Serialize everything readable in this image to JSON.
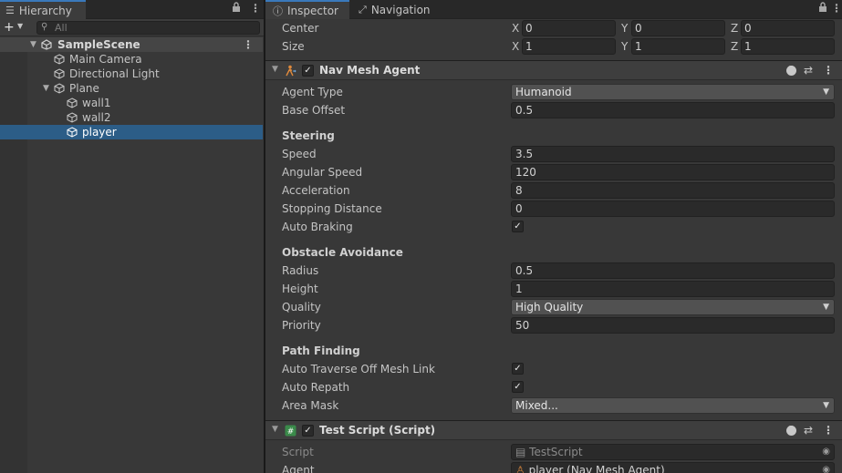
{
  "hierarchy": {
    "tab_label": "Hierarchy",
    "search_placeholder": "All",
    "add_label": "+",
    "items": [
      {
        "label": "SampleScene",
        "kind": "scene"
      },
      {
        "label": "Main Camera",
        "kind": "object"
      },
      {
        "label": "Directional Light",
        "kind": "object"
      },
      {
        "label": "Plane",
        "kind": "object",
        "expanded": true
      },
      {
        "label": "wall1",
        "kind": "object"
      },
      {
        "label": "wall2",
        "kind": "object"
      },
      {
        "label": "player",
        "kind": "object",
        "selected": true
      }
    ]
  },
  "inspector": {
    "tabs": [
      "Inspector",
      "Navigation"
    ],
    "collider": {
      "center": {
        "label": "Center",
        "x": "0",
        "y": "0",
        "z": "0"
      },
      "size": {
        "label": "Size",
        "x": "1",
        "y": "1",
        "z": "1"
      }
    },
    "nav_mesh_agent": {
      "title": "Nav Mesh Agent",
      "enabled": true,
      "agent_type": {
        "label": "Agent Type",
        "value": "Humanoid"
      },
      "base_offset": {
        "label": "Base Offset",
        "value": "0.5"
      },
      "steering": {
        "header": "Steering",
        "speed": {
          "label": "Speed",
          "value": "3.5"
        },
        "angular_speed": {
          "label": "Angular Speed",
          "value": "120"
        },
        "acceleration": {
          "label": "Acceleration",
          "value": "8"
        },
        "stopping_distance": {
          "label": "Stopping Distance",
          "value": "0"
        },
        "auto_braking": {
          "label": "Auto Braking",
          "checked": true
        }
      },
      "obstacle_avoidance": {
        "header": "Obstacle Avoidance",
        "radius": {
          "label": "Radius",
          "value": "0.5"
        },
        "height": {
          "label": "Height",
          "value": "1"
        },
        "quality": {
          "label": "Quality",
          "value": "High Quality"
        },
        "priority": {
          "label": "Priority",
          "value": "50"
        }
      },
      "path_finding": {
        "header": "Path Finding",
        "auto_traverse": {
          "label": "Auto Traverse Off Mesh Link",
          "checked": true
        },
        "auto_repath": {
          "label": "Auto Repath",
          "checked": true
        },
        "area_mask": {
          "label": "Area Mask",
          "value": "Mixed..."
        }
      }
    },
    "test_script": {
      "title": "Test Script (Script)",
      "enabled": true,
      "script": {
        "label": "Script",
        "value": "TestScript"
      },
      "agent": {
        "label": "Agent",
        "value": "player (Nav Mesh Agent)"
      }
    }
  },
  "icons": {
    "hierarchy_tab": "list-icon",
    "inspector_tab": "info-icon",
    "navigation_tab": "navigation-icon",
    "lock": "lock-icon",
    "menu": "kebab-menu-icon",
    "help": "help-icon",
    "presets": "sliders-icon",
    "game_object": "cube-icon",
    "scene": "unity-scene-icon",
    "script": "script-icon",
    "nav_agent": "nav-agent-icon"
  },
  "colors": {
    "selection": "#2c5d87",
    "tab_accent": "#3a79bb",
    "panel_bg": "#383838"
  }
}
